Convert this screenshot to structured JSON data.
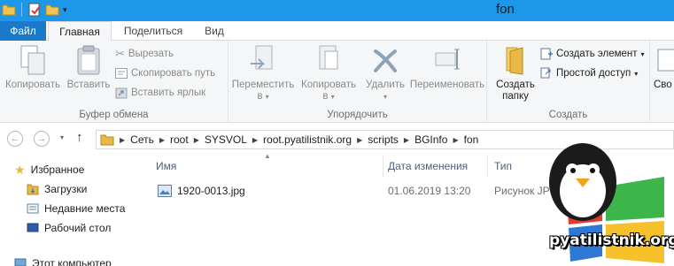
{
  "window": {
    "title": "fon"
  },
  "ribbon_tabs": {
    "file": "Файл",
    "home": "Главная",
    "share": "Поделиться",
    "view": "Вид"
  },
  "clipboard": {
    "copy": "Копировать",
    "paste": "Вставить",
    "cut": "Вырезать",
    "copy_path": "Скопировать путь",
    "paste_shortcut": "Вставить ярлык",
    "group_label": "Буфер обмена"
  },
  "organize": {
    "move_to_line1": "Переместить",
    "move_to_line2": "в",
    "copy_to_line1": "Копировать",
    "copy_to_line2": "в",
    "delete": "Удалить",
    "rename": "Переименовать",
    "group_label": "Упорядочить"
  },
  "create": {
    "new_folder_line1": "Создать",
    "new_folder_line2": "папку",
    "new_item": "Создать элемент",
    "easy_access": "Простой доступ",
    "group_label": "Создать"
  },
  "open_group": {
    "partial_label": "Сво"
  },
  "address": {
    "crumbs": [
      "Сеть",
      "root",
      "SYSVOL",
      "root.pyatilistnik.org",
      "scripts",
      "BGInfo",
      "fon"
    ]
  },
  "navpane": {
    "favorites": "Избранное",
    "downloads": "Загрузки",
    "recent": "Недавние места",
    "desktop": "Рабочий стол",
    "this_pc": "Этот компьютер"
  },
  "columns": {
    "name": "Имя",
    "date": "Дата изменения",
    "type": "Тип"
  },
  "files": [
    {
      "name": "1920-0013.jpg",
      "date": "01.06.2019 13:20",
      "type": "Рисунок JP"
    }
  ],
  "watermark": {
    "text": "pyatilistnik.org"
  },
  "colors": {
    "titlebar": "#1c97ea",
    "file_tab": "#1979ca",
    "ribbon_bg": "#f5f6f7",
    "folder": "#e8b945"
  }
}
